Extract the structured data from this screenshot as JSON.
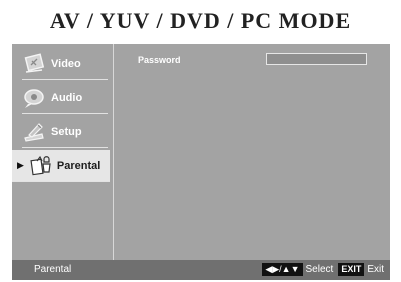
{
  "header": {
    "title": "AV / YUV / DVD / PC  MODE"
  },
  "sidebar": {
    "items": [
      {
        "label": "Video",
        "icon": "video-icon",
        "selected": false
      },
      {
        "label": "Audio",
        "icon": "audio-icon",
        "selected": false
      },
      {
        "label": "Setup",
        "icon": "setup-icon",
        "selected": false
      },
      {
        "label": "Parental",
        "icon": "parental-icon",
        "selected": true
      }
    ]
  },
  "content": {
    "password_label": "Password",
    "password_value": ""
  },
  "status_bar": {
    "current_menu": "Parental",
    "nav_key": "◀▶/▲▼",
    "select_label": "Select",
    "exit_key": "EXIT",
    "exit_label": "Exit"
  },
  "colors": {
    "panel": "#a3a3a3",
    "status_bar": "#707070",
    "highlight": "#e6e6e6"
  }
}
